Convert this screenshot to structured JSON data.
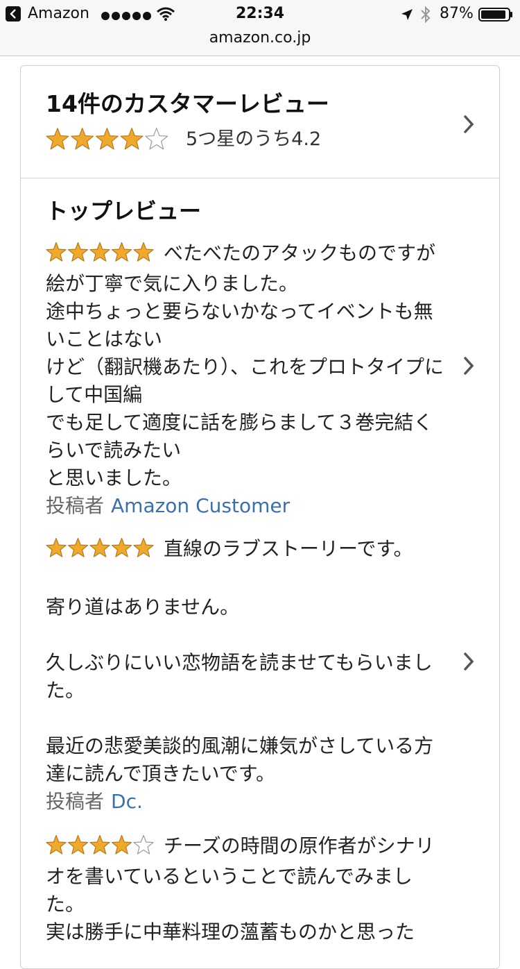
{
  "status_bar": {
    "back_app": "Amazon",
    "time": "22:34",
    "battery": "87%",
    "icons": [
      "back-arrow-icon",
      "signal-dots-icon",
      "wifi-icon",
      "location-arrow-icon",
      "bluetooth-icon",
      "battery-icon"
    ]
  },
  "browser": {
    "url": "amazon.co.jp"
  },
  "summary": {
    "title": "14件のカスタマーレビュー",
    "rating_text": "5つ星のうち4.2",
    "rating_value": 4.2,
    "stars_filled": 4
  },
  "top_reviews": {
    "heading": "トップレビュー",
    "author_prefix": "投稿者",
    "items": [
      {
        "stars": 5,
        "text": "べたべたのアタックものですが絵が丁寧で気に入りました。\n途中ちょっと要らないかなってイベントも無いことはない\nけど（翻訳機あたり）、これをプロトタイプにして中国編\nでも足して適度に話を膨らまして３巻完結くらいで読みたい\nと思いました。",
        "author": "Amazon Customer"
      },
      {
        "stars": 5,
        "text": "直線のラブストーリーです。\n\n寄り道はありません。\n\n久しぶりにいい恋物語を読ませてもらいました。\n\n最近の悲愛美談的風潮に嫌気がさしている方達に読んで頂きたいです。",
        "author": "Dc."
      },
      {
        "stars": 4,
        "text": "チーズの時間の原作者がシナリオを書いているということで読んでみました。\n実は勝手に中華料理の薀蓄ものかと思った",
        "author": ""
      }
    ]
  },
  "colors": {
    "star_fill": "#f0a92b",
    "star_stroke": "#b7791d",
    "link": "#3a6fb0"
  }
}
